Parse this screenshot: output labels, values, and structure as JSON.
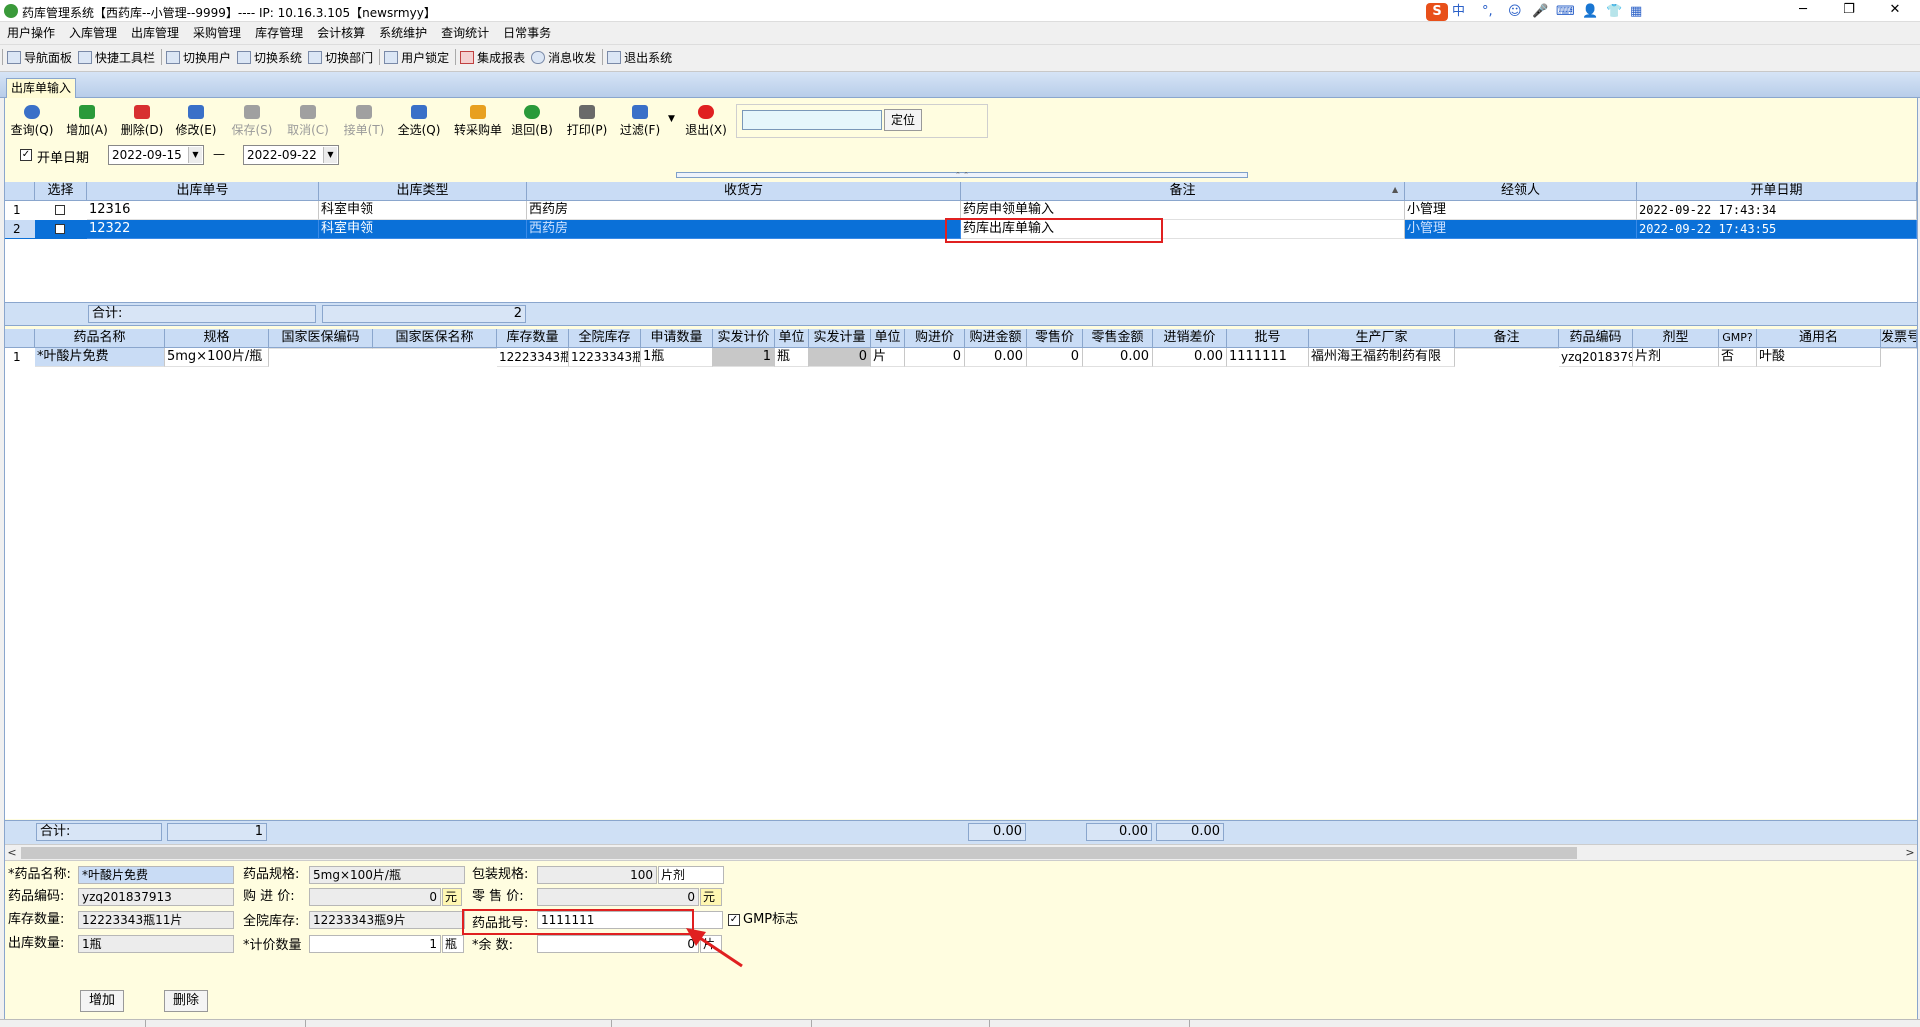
{
  "window": {
    "title": "药库管理系统【西药库--小管理--9999】---- IP: 10.16.3.105【newsrmyy】",
    "ime": [
      "S",
      "中",
      "°,",
      "☺",
      "🎤",
      "⌨",
      "👤",
      "👕",
      "▦"
    ],
    "controls": {
      "minimize": "─",
      "restore": "❐",
      "close": "✕"
    }
  },
  "menu": [
    "用户操作",
    "入库管理",
    "出库管理",
    "采购管理",
    "库存管理",
    "会计核算",
    "系统维护",
    "查询统计",
    "日常事务"
  ],
  "toolbar": [
    "导航面板",
    "快捷工具栏",
    "切换用户",
    "切换系统",
    "切换部门",
    "用户锁定",
    "集成报表",
    "消息收发",
    "退出系统"
  ],
  "tab": {
    "label": "出库单输入"
  },
  "actions": [
    {
      "label": "查询(Q)",
      "icon": "refresh-icon",
      "color": "#3a70c8",
      "enabled": true
    },
    {
      "label": "增加(A)",
      "icon": "add-icon",
      "color": "#2a9a3a",
      "enabled": true
    },
    {
      "label": "删除(D)",
      "icon": "delete-icon",
      "color": "#d83030",
      "enabled": true
    },
    {
      "label": "修改(E)",
      "icon": "edit-icon",
      "color": "#3a70c8",
      "enabled": true
    },
    {
      "label": "保存(S)",
      "icon": "save-icon",
      "color": "#a0a0a0",
      "enabled": false
    },
    {
      "label": "取消(C)",
      "icon": "cancel-icon",
      "color": "#a0a0a0",
      "enabled": false
    },
    {
      "label": "接单(T)",
      "icon": "receive-icon",
      "color": "#a0a0a0",
      "enabled": false
    },
    {
      "label": "全选(Q)",
      "icon": "select-all-icon",
      "color": "#3a70c8",
      "enabled": true
    },
    {
      "label": "转采购单",
      "icon": "transfer-icon",
      "color": "#e8a020",
      "enabled": true
    },
    {
      "label": "退回(B)",
      "icon": "return-icon",
      "color": "#2a9a3a",
      "enabled": true
    },
    {
      "label": "打印(P)",
      "icon": "print-icon",
      "color": "#6a6a6a",
      "enabled": true
    },
    {
      "label": "过滤(F)",
      "icon": "filter-icon",
      "color": "#3a70c8",
      "enabled": true
    },
    {
      "label": "退出(X)",
      "icon": "exit-icon",
      "color": "#e02020",
      "enabled": true
    }
  ],
  "locate": {
    "value": "",
    "button": "定位"
  },
  "date_filter": {
    "checked": "✓",
    "label": "开单日期",
    "from": "2022-09-15",
    "sep": "—",
    "to": "2022-09-22"
  },
  "orders": {
    "columns": [
      "选择",
      "出库单号",
      "出库类型",
      "收货方",
      "备注",
      "经领人",
      "开单日期"
    ],
    "rows": [
      {
        "num": "1",
        "no": "12316",
        "type": "科室申领",
        "receiver": "西药房",
        "note": "药房申领单输入",
        "handler": "小管理",
        "date": "2022-09-22 17:43:34",
        "selected": false
      },
      {
        "num": "2",
        "no": "12322",
        "type": "科室申领",
        "receiver": "西药房",
        "note": "药库出库单输入",
        "handler": "小管理",
        "date": "2022-09-22 17:43:55",
        "selected": true
      }
    ],
    "sum_label": "合计:",
    "sum_count": "2"
  },
  "items": {
    "columns": [
      "药品名称",
      "规格",
      "国家医保编码",
      "国家医保名称",
      "库存数量",
      "全院库存",
      "申请数量",
      "实发计价",
      "单位",
      "实发计量",
      "单位",
      "购进价",
      "购进金额",
      "零售价",
      "零售金额",
      "进销差价",
      "批号",
      "生产厂家",
      "备注",
      "药品编码",
      "剂型",
      "GMP?",
      "通用名",
      "发票号"
    ],
    "rows": [
      {
        "num": "1",
        "cells": [
          "*叶酸片免费",
          "5mg×100片/瓶",
          "",
          "",
          "12223343瓶",
          "12233343瓶",
          "1瓶",
          "1",
          "瓶",
          "0",
          "片",
          "0",
          "0.00",
          "0",
          "0.00",
          "0.00",
          "1111111",
          "福州海王福药制药有限",
          "",
          "yzq2018379",
          "片剂",
          "否",
          "叶酸",
          ""
        ]
      }
    ],
    "sum_label": "合计:",
    "sum_count": "1",
    "sum_amounts": [
      "0.00",
      "0.00",
      "0.00"
    ]
  },
  "detail": {
    "name_label": "*药品名称:",
    "name": "*叶酸片免费",
    "spec_label": "药品规格:",
    "spec": "5mg×100片/瓶",
    "pack_label": "包装规格:",
    "pack": "100",
    "pack_unit": "片剂",
    "code_label": "药品编码:",
    "code": "yzq201837913",
    "buy_label": "购 进 价:",
    "buy": "0",
    "buy_unit": "元",
    "retail_label": "零 售 价:",
    "retail": "0",
    "retail_unit": "元",
    "stock_label": "库存数量:",
    "stock": "12223343瓶11片",
    "hosp_label": "全院库存:",
    "hosp": "12233343瓶9片",
    "batch_label": "药品批号:",
    "batch": "1111111",
    "gmp_check": "✓",
    "gmp_label": "GMP标志",
    "out_label": "出库数量:",
    "out": "1瓶",
    "price_qty_label": "*计价数量",
    "price_qty": "1",
    "price_unit": "瓶",
    "rest_label": "*余    数:",
    "rest": "0",
    "rest_unit": "片"
  },
  "buttons": {
    "add": "增加",
    "delete": "删除"
  }
}
